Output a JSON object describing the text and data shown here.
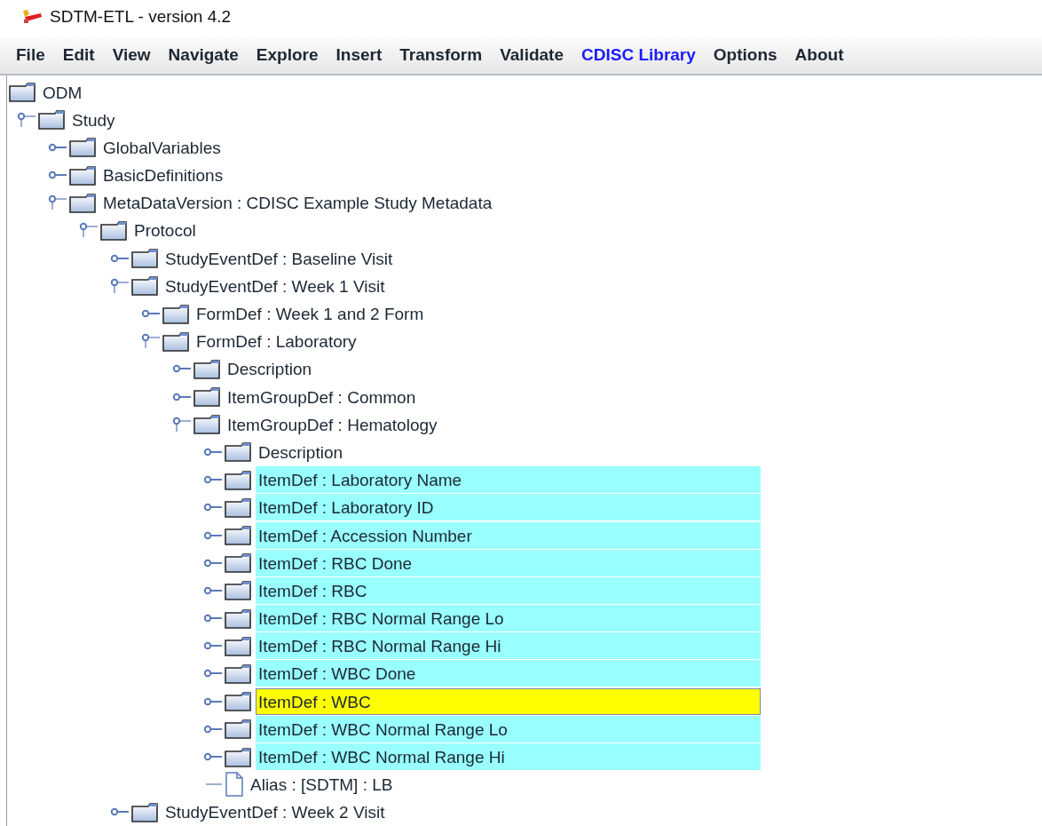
{
  "window": {
    "title": "SDTM-ETL - version 4.2"
  },
  "menu": [
    {
      "label": "File",
      "selected": false
    },
    {
      "label": "Edit",
      "selected": false
    },
    {
      "label": "View",
      "selected": false
    },
    {
      "label": "Navigate",
      "selected": false
    },
    {
      "label": "Explore",
      "selected": false
    },
    {
      "label": "Insert",
      "selected": false
    },
    {
      "label": "Transform",
      "selected": false
    },
    {
      "label": "Validate",
      "selected": false
    },
    {
      "label": "CDISC Library",
      "selected": true
    },
    {
      "label": "Options",
      "selected": false
    },
    {
      "label": "About",
      "selected": false
    }
  ],
  "tree": [
    {
      "label": "ODM",
      "kind": "root",
      "selected": false,
      "marked": false,
      "children": [
        {
          "label": "Study",
          "kind": "folder",
          "expanded": true,
          "selected": false,
          "marked": false,
          "children": [
            {
              "label": "GlobalVariables",
              "kind": "folder",
              "expanded": false,
              "selected": false,
              "marked": false
            },
            {
              "label": "BasicDefinitions",
              "kind": "folder",
              "expanded": false,
              "selected": false,
              "marked": false
            },
            {
              "label": "MetaDataVersion : CDISC Example Study Metadata",
              "kind": "folder",
              "expanded": true,
              "selected": false,
              "marked": false,
              "children": [
                {
                  "label": "Protocol",
                  "kind": "folder",
                  "expanded": true,
                  "selected": false,
                  "marked": false,
                  "children": [
                    {
                      "label": "StudyEventDef : Baseline Visit",
                      "kind": "folder",
                      "expanded": false,
                      "selected": false,
                      "marked": false
                    },
                    {
                      "label": "StudyEventDef : Week 1 Visit",
                      "kind": "folder",
                      "expanded": true,
                      "selected": false,
                      "marked": false,
                      "children": [
                        {
                          "label": "FormDef : Week 1 and 2 Form",
                          "kind": "folder",
                          "expanded": false,
                          "selected": false,
                          "marked": false
                        },
                        {
                          "label": "FormDef : Laboratory",
                          "kind": "folder",
                          "expanded": true,
                          "selected": false,
                          "marked": false,
                          "children": [
                            {
                              "label": "Description",
                              "kind": "folder",
                              "expanded": false,
                              "selected": false,
                              "marked": false
                            },
                            {
                              "label": "ItemGroupDef : Common",
                              "kind": "folder",
                              "expanded": false,
                              "selected": false,
                              "marked": false
                            },
                            {
                              "label": "ItemGroupDef : Hematology",
                              "kind": "folder",
                              "expanded": true,
                              "selected": false,
                              "marked": false,
                              "children": [
                                {
                                  "label": "Description",
                                  "kind": "folder",
                                  "expanded": false,
                                  "selected": false,
                                  "marked": false
                                },
                                {
                                  "label": "ItemDef : Laboratory Name",
                                  "kind": "folder",
                                  "expanded": false,
                                  "selected": false,
                                  "marked": true
                                },
                                {
                                  "label": "ItemDef : Laboratory ID",
                                  "kind": "folder",
                                  "expanded": false,
                                  "selected": false,
                                  "marked": true
                                },
                                {
                                  "label": "ItemDef : Accession Number",
                                  "kind": "folder",
                                  "expanded": false,
                                  "selected": false,
                                  "marked": true
                                },
                                {
                                  "label": "ItemDef : RBC Done",
                                  "kind": "folder",
                                  "expanded": false,
                                  "selected": false,
                                  "marked": true
                                },
                                {
                                  "label": "ItemDef : RBC",
                                  "kind": "folder",
                                  "expanded": false,
                                  "selected": false,
                                  "marked": true
                                },
                                {
                                  "label": "ItemDef : RBC Normal Range Lo",
                                  "kind": "folder",
                                  "expanded": false,
                                  "selected": false,
                                  "marked": true
                                },
                                {
                                  "label": "ItemDef : RBC Normal Range Hi",
                                  "kind": "folder",
                                  "expanded": false,
                                  "selected": false,
                                  "marked": true
                                },
                                {
                                  "label": "ItemDef : WBC Done",
                                  "kind": "folder",
                                  "expanded": false,
                                  "selected": false,
                                  "marked": true
                                },
                                {
                                  "label": "ItemDef : WBC",
                                  "kind": "folder",
                                  "expanded": false,
                                  "selected": true,
                                  "marked": true
                                },
                                {
                                  "label": "ItemDef : WBC Normal Range Lo",
                                  "kind": "folder",
                                  "expanded": false,
                                  "selected": false,
                                  "marked": true
                                },
                                {
                                  "label": "ItemDef : WBC Normal Range Hi",
                                  "kind": "folder",
                                  "expanded": false,
                                  "selected": false,
                                  "marked": true
                                },
                                {
                                  "label": "Alias : [SDTM] : LB",
                                  "kind": "leaf",
                                  "selected": false,
                                  "marked": false
                                }
                              ]
                            }
                          ]
                        }
                      ]
                    },
                    {
                      "label": "StudyEventDef : Week 2 Visit",
                      "kind": "folder",
                      "expanded": false,
                      "selected": false,
                      "marked": false
                    }
                  ]
                }
              ]
            }
          ]
        }
      ]
    }
  ]
}
